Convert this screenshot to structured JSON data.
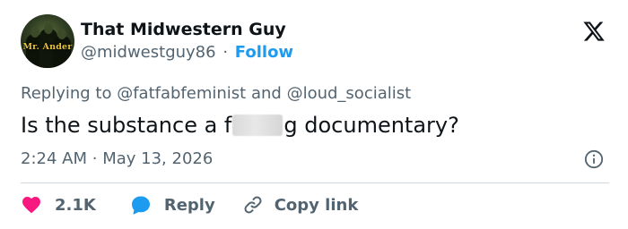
{
  "author": {
    "display_name": "That Midwestern Guy",
    "handle": "@midwestguy86",
    "separator": "·",
    "follow_label": "Follow",
    "avatar_caption": "Mr. Ander"
  },
  "reply_context": {
    "prefix": "Replying to",
    "mention_1": "@fatfabfeminist",
    "conjunction": "and",
    "mention_2": "@loud_socialist"
  },
  "tweet": {
    "text_before_censor": "Is the substance a f",
    "text_after_censor": "g documentary?",
    "time": "2:24 AM",
    "separator": "·",
    "date": "May 13, 2026"
  },
  "actions": {
    "like_count": "2.1K",
    "reply_label": "Reply",
    "copy_label": "Copy link"
  },
  "colors": {
    "accent": "#1d9bf0",
    "like": "#f91880",
    "muted": "#536471",
    "text": "#0f1419",
    "divider": "#cfd9de"
  },
  "icons": [
    "x-logo-icon",
    "info-icon",
    "heart-icon",
    "reply-bubble-icon",
    "link-icon"
  ]
}
